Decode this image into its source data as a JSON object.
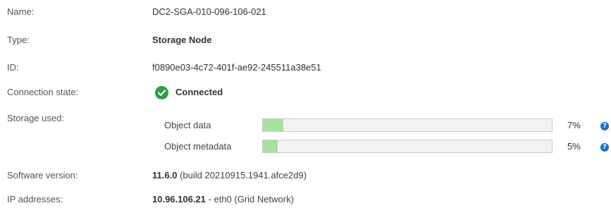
{
  "fields": {
    "name": {
      "label": "Name:",
      "value": "DC2-SGA-010-096-106-021"
    },
    "type": {
      "label": "Type:",
      "value": "Storage Node"
    },
    "id": {
      "label": "ID:",
      "value": "f0890e03-4c72-401f-ae92-245511a38e51"
    },
    "connection_state": {
      "label": "Connection state:",
      "value": "Connected",
      "icon": "check-circle-icon",
      "color": "#2f9e44"
    },
    "storage_used": {
      "label": "Storage used:",
      "items": [
        {
          "label": "Object data",
          "percent_text": "7%",
          "fraction": 0.07
        },
        {
          "label": "Object metadata",
          "percent_text": "5%",
          "fraction": 0.05
        }
      ],
      "help_icon": "help-icon",
      "help_glyph": "?"
    },
    "software_version": {
      "label": "Software version:",
      "version": "11.6.0",
      "build": "(build 20210915.1941.afce2d9)"
    },
    "ip_addresses": {
      "label": "IP addresses:",
      "ip": "10.96.106.21",
      "detail": "- eth0 (Grid Network)"
    }
  },
  "colors": {
    "bar_fill": "#a8e0a0",
    "bar_track": "#f2f2f2",
    "help": "#1a73c8"
  }
}
